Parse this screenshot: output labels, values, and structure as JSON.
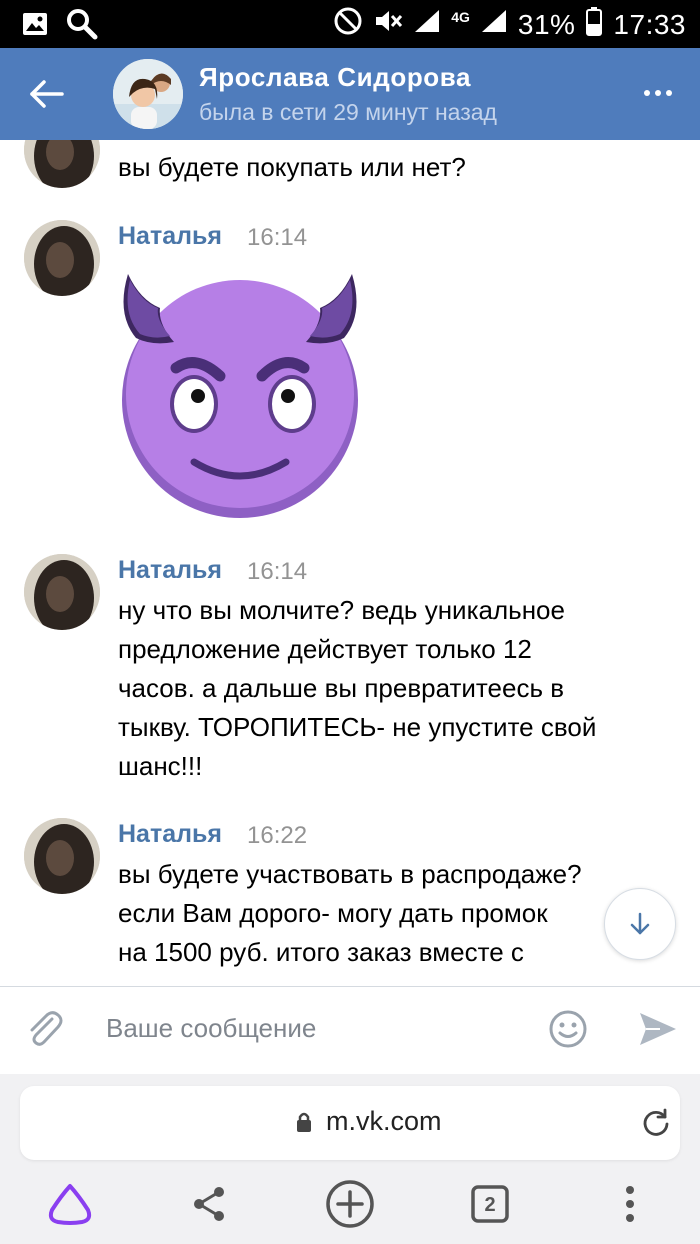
{
  "status_bar": {
    "network": "4G",
    "battery": "31%",
    "time": "17:33",
    "icons": [
      "gallery-icon",
      "search-icon",
      "dnd-icon",
      "mute-icon",
      "signal-icon",
      "battery-icon"
    ]
  },
  "header": {
    "name": "Ярослава Сидорова",
    "status": "была в сети 29 минут назад"
  },
  "messages": [
    {
      "text": "вы будете покупать или нет?"
    },
    {
      "sender": "Наталья",
      "time": "16:14",
      "sticker": "purple-devil-emoji"
    },
    {
      "sender": "Наталья",
      "time": "16:14",
      "lines": [
        "ну что вы молчите? ведь уникальное",
        "предложение действует только 12",
        "часов. а дальше вы превратитеесь в",
        "тыкву. ТОРОПИТЕСЬ- не упустите свой",
        "шанс!!!"
      ]
    },
    {
      "sender": "Наталья",
      "time": "16:22",
      "lines": [
        "вы будете участвовать в распродаже?",
        "если Вам дорого- могу дать промок",
        "на 1500 руб. итого заказ вместе с"
      ]
    }
  ],
  "composer": {
    "placeholder": "Ваше сообщение"
  },
  "browser": {
    "url": "m.vk.com",
    "tabs_count": "2"
  },
  "colors": {
    "header": "#4f7cbc",
    "sender": "#4a76a8",
    "sticker": "#b67fe6",
    "horns": "#5a3a8f"
  }
}
